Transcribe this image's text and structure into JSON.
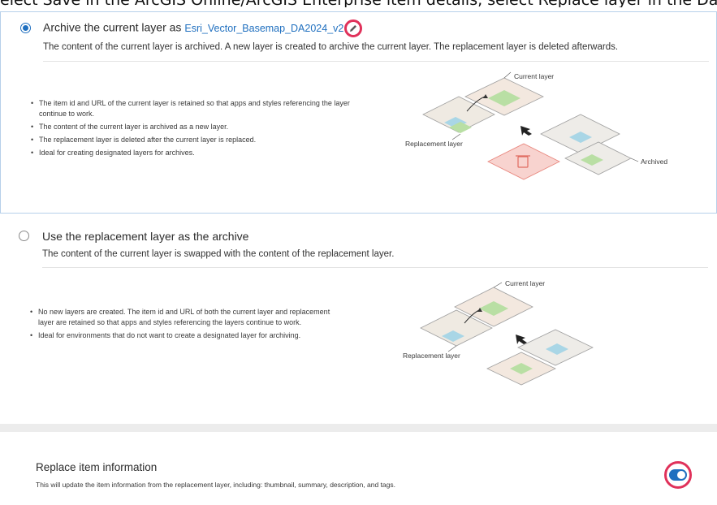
{
  "header": {
    "cut_text": "elect Save in the ArcGIS Online/ArcGIS Enterprise item details, select Replace layer in the Data tab and the Layer section"
  },
  "option_archive": {
    "title_prefix": "Archive the current layer as",
    "layer_name": "Esri_Vector_Basemap_DA2024_v2",
    "description": "The content of the current layer is archived. A new layer is created to archive the current layer. The replacement layer is deleted afterwards.",
    "selected": true,
    "bullets": [
      "The item id and URL of the current layer is retained so that apps and styles referencing the layer continue to work.",
      "The content of the current layer is archived as a new layer.",
      "The replacement layer is deleted after the current layer is replaced.",
      "Ideal for creating designated layers for archives."
    ],
    "diagram_labels": {
      "current": "Current layer",
      "replacement": "Replacement layer",
      "archived": "Archived"
    }
  },
  "option_replacement": {
    "title": "Use the replacement layer as the archive",
    "description": "The content of the current layer is swapped with the content of the replacement layer.",
    "selected": false,
    "bullets": [
      "No new layers are created. The item id and URL of both the current layer and replacement layer are retained so that apps and styles referencing the layers continue to work.",
      "Ideal for environments that do not want to create a designated layer for archiving."
    ],
    "diagram_labels": {
      "current": "Current layer",
      "replacement": "Replacement layer"
    }
  },
  "replace_item": {
    "title": "Replace item information",
    "description": "This will update the item information from the replacement layer, including: thumbnail, summary, description, and tags.",
    "enabled": true
  },
  "colors": {
    "accent": "#1f6fbf",
    "highlight_ring": "#e0315a",
    "delete_fill": "#f8d3cf"
  },
  "icons": [
    "pencil-icon",
    "trash-icon",
    "arrow-icon"
  ]
}
